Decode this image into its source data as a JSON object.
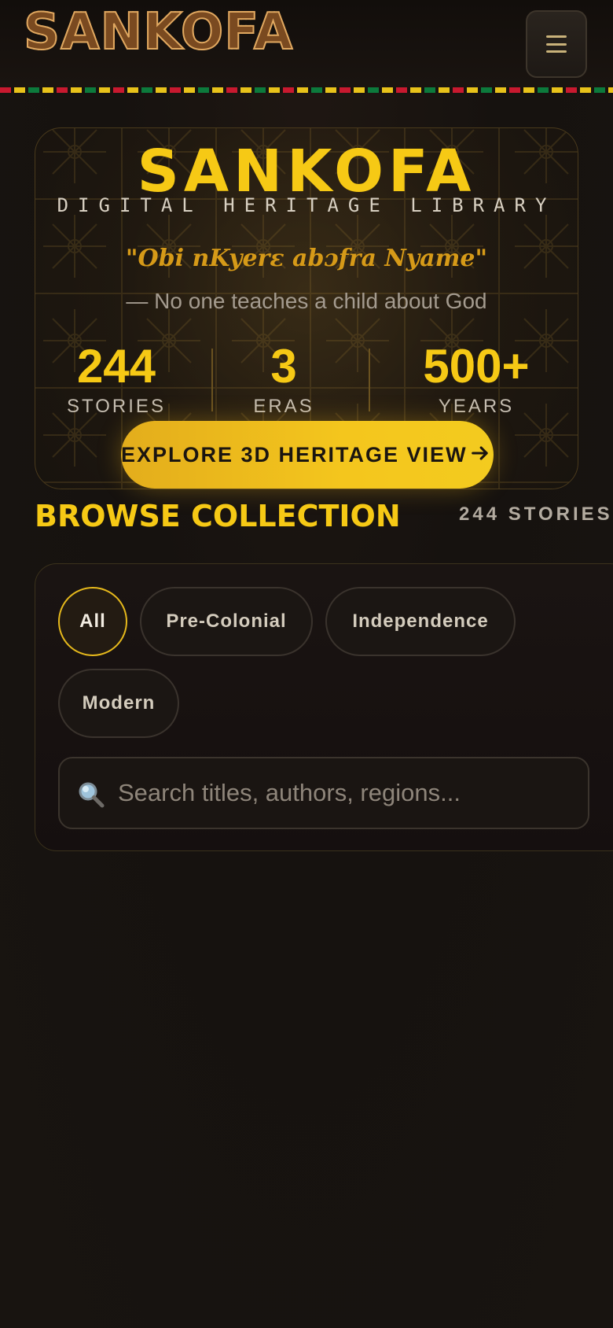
{
  "header": {
    "logo_text": "SANKOFA",
    "menu_icon": "hamburger-menu-icon"
  },
  "hero": {
    "title": "SANKOFA",
    "subtitle": "DIGITAL HERITAGE LIBRARY",
    "proverb": "\"Obi nKyerɛ abɔfra Nyame\"",
    "translation": "— No one teaches a child about God",
    "stats": [
      {
        "value": "244",
        "label": "STORIES"
      },
      {
        "value": "3",
        "label": "ERAS"
      },
      {
        "value": "500+",
        "label": "YEARS"
      }
    ],
    "cta_label": "EXPLORE 3D HERITAGE VIEW",
    "cta_icon": "arrow-right-icon"
  },
  "browse": {
    "title": "BROWSE COLLECTION",
    "count": "244 STORIES",
    "filters": [
      "All",
      "Pre-Colonial",
      "Independence",
      "Modern"
    ],
    "active_filter": "All",
    "search_placeholder": "Search titles, authors, regions...",
    "search_value": "",
    "search_icon": "magnifier-icon"
  },
  "colors": {
    "accent_gold": "#f6c915",
    "background": "#16120f",
    "kente_red": "#c8192f",
    "kente_green": "#0c7a3c"
  }
}
